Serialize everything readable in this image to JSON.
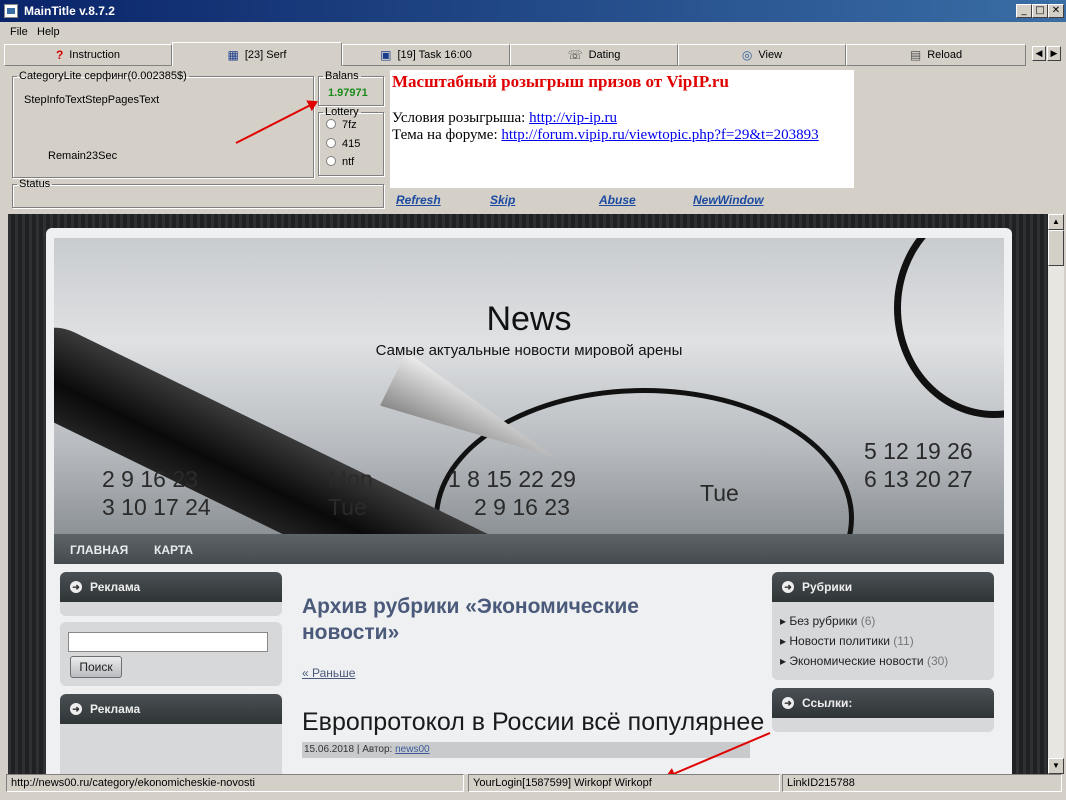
{
  "window": {
    "title": "MainTitle v.8.7.2",
    "min": "_",
    "max": "□",
    "close": "✕"
  },
  "menu": {
    "file": "File",
    "help": "Help"
  },
  "tabs": [
    {
      "label": "Instruction",
      "icon": "question-icon",
      "glyph": "?"
    },
    {
      "label": "[23] Serf",
      "icon": "film-icon",
      "glyph": "▦"
    },
    {
      "label": "[19] Task 16:00",
      "icon": "window-icon",
      "glyph": "▣"
    },
    {
      "label": "Dating",
      "icon": "chat-icon",
      "glyph": "☏"
    },
    {
      "label": "View",
      "icon": "view-icon",
      "glyph": "◎"
    },
    {
      "label": "Reload",
      "icon": "grid-icon",
      "glyph": "▤"
    }
  ],
  "panel": {
    "category_legend": "CategoryLite серфинг(0.002385$)",
    "step_text": "StepInfoTextStepPagesText",
    "remain": "Remain23Sec",
    "balans_legend": "Balans",
    "balans_value": "1.97971",
    "lottery_legend": "Lottery",
    "lottery_options": [
      "7fz",
      "415",
      "ntf"
    ],
    "status_legend": "Status",
    "ad": {
      "title": "Масштабный розыгрыш призов от VipIP.ru",
      "line1_prefix": "Условия розыгрыша: ",
      "line1_link": "http://vip-ip.ru",
      "line2_prefix": "Тема на форуме: ",
      "line2_link": "http://forum.vipip.ru/viewtopic.php?f=29&t=203893"
    },
    "actions": {
      "refresh": "Refresh",
      "skip": "Skip",
      "abuse": "Abuse",
      "newwindow": "NewWindow"
    }
  },
  "site": {
    "title": "News",
    "tagline": "Самые актуальные новости мировой арены",
    "nav": [
      "ГЛАВНАЯ",
      "КАРТА"
    ],
    "left_widget1": "Реклама",
    "search_button": "Поиск",
    "left_widget2": "Реклама",
    "archive_heading": "Архив рубрики «Экономические новости»",
    "prev_link": "« Раньше",
    "post_title": "Европротокол в России всё популярнее",
    "post_meta_prefix": "15.06.2018 | Автор: ",
    "post_author": "news00",
    "right_widget1": "Рубрики",
    "categories": [
      {
        "name": "Без рубрики",
        "count": "(6)"
      },
      {
        "name": "Новости политики",
        "count": "(11)"
      },
      {
        "name": "Экономические новости",
        "count": "(30)"
      }
    ],
    "right_widget2": "Ссылки:",
    "calendar": {
      "row1": "2   9 16 23",
      "row1b": "Mon",
      "row1c": "1   8 15 22 29",
      "row1d": "5 12 19 26",
      "row2": "3 10 17 24",
      "row2b": "Tue",
      "row2c": "2   9 16 23",
      "row2d": "Tue",
      "row2e": "6 13 20 27"
    }
  },
  "status": {
    "url": "http://news00.ru/category/ekonomicheskie-novosti",
    "login": "YourLogin[1587599] Wirkopf Wirkopf",
    "link_id": "LinkID215788"
  }
}
